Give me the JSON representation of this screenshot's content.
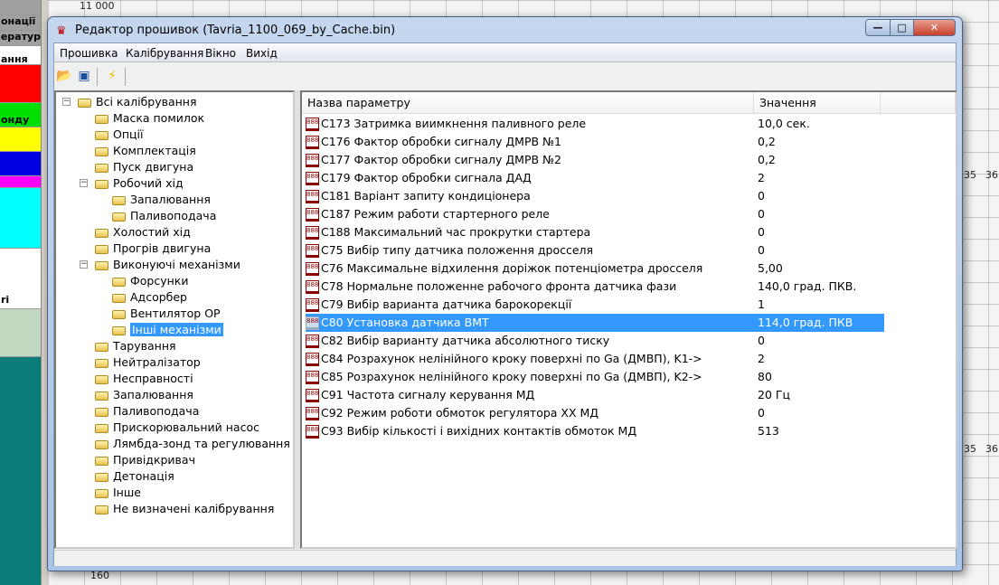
{
  "background": {
    "left_labels": [
      "онації",
      "ператур",
      "ання",
      "онду",
      "ri"
    ],
    "axis_labels": {
      "y_top": "11 000",
      "y_bottom": "160",
      "x_ticks": [
        "35",
        "36"
      ]
    },
    "strip_colors": [
      "#ff0000",
      "#00e000",
      "#ffff00",
      "#0000e0",
      "#ff00ff",
      "#00ffff",
      "#ffffff",
      "#c0d8c0"
    ]
  },
  "window": {
    "title": "Редактор прошивок (Tavria_1100_069_by_Cache.bin)",
    "minimize": "—",
    "maximize": "□",
    "close": "✕"
  },
  "menu": [
    "Прошивка",
    "Калібрування",
    "Вікно",
    "Вихід"
  ],
  "toolbar": {
    "icons": [
      "open-folder-icon",
      "save-disk-icon",
      "lightning-icon"
    ]
  },
  "tree": [
    {
      "label": "Всі калібрування",
      "level": 0,
      "expanded": true
    },
    {
      "label": "Маска помилок",
      "level": 1
    },
    {
      "label": "Опції",
      "level": 1
    },
    {
      "label": "Комплектація",
      "level": 1
    },
    {
      "label": "Пуск двигуна",
      "level": 1
    },
    {
      "label": "Робочий хід",
      "level": 1,
      "expanded": true
    },
    {
      "label": "Запалювання",
      "level": 2
    },
    {
      "label": "Паливоподача",
      "level": 2
    },
    {
      "label": "Холостий хід",
      "level": 1
    },
    {
      "label": "Прогрів двигуна",
      "level": 1
    },
    {
      "label": "Виконуючі механізми",
      "level": 1,
      "expanded": true
    },
    {
      "label": "Форсунки",
      "level": 2
    },
    {
      "label": "Адсорбер",
      "level": 2
    },
    {
      "label": "Вентилятор ОР",
      "level": 2
    },
    {
      "label": "Інші механізми",
      "level": 2,
      "selected": true
    },
    {
      "label": "Тарування",
      "level": 1
    },
    {
      "label": "Нейтралізатор",
      "level": 1
    },
    {
      "label": "Несправності",
      "level": 1
    },
    {
      "label": "Запалювання",
      "level": 1
    },
    {
      "label": "Паливоподача",
      "level": 1
    },
    {
      "label": "Прискорювальний насос",
      "level": 1
    },
    {
      "label": "Лямбда-зонд та регулювання",
      "level": 1
    },
    {
      "label": "Привідкривач",
      "level": 1
    },
    {
      "label": "Детонація",
      "level": 1
    },
    {
      "label": "Інше",
      "level": 1
    },
    {
      "label": "Не визначені калібрування",
      "level": 1
    }
  ],
  "list": {
    "columns": [
      "Назва параметру",
      "Значення"
    ],
    "rows": [
      {
        "name": "C173 Затримка виимкнення паливного реле",
        "value": "10,0 сек."
      },
      {
        "name": "C176 Фактор обробки сигналу ДМРВ №1",
        "value": "0,2"
      },
      {
        "name": "C177 Фактор обробки сигналу ДМРВ №2",
        "value": "0,2"
      },
      {
        "name": "C179 Фактор обробки сигнала ДАД",
        "value": "2"
      },
      {
        "name": "C181 Варіант запиту кондиціонера",
        "value": "0"
      },
      {
        "name": "C187 Режим работи стартерного реле",
        "value": "0"
      },
      {
        "name": "C188 Максимальний час прокрутки стартера",
        "value": "0"
      },
      {
        "name": "C75 Вибір типу датчика положення дросселя",
        "value": "0"
      },
      {
        "name": "C76 Максимальне відхилення доріжок потенціометра дросселя",
        "value": "5,00"
      },
      {
        "name": "C78 Нормальне положенне рабочого фронта датчика фази",
        "value": "140,0 град. ПКВ."
      },
      {
        "name": "C79 Вибір варианта датчика барокорекції",
        "value": "1"
      },
      {
        "name": "C80 Установка датчика ВМТ",
        "value": "114,0 град. ПКВ",
        "selected": true
      },
      {
        "name": "C82 Вибір варианту датчика абсолютного тиску",
        "value": "0"
      },
      {
        "name": "C84 Розрахунок нелінійного кроку поверхні по Ga (ДМВП), K1->",
        "value": "2"
      },
      {
        "name": "C85 Розрахунок нелінійного кроку поверхні по Ga (ДМВП), K2->",
        "value": "80"
      },
      {
        "name": "C91 Частота сигналу керування МД",
        "value": "20 Гц"
      },
      {
        "name": "C92 Режим роботи обмоток регулятора ХХ МД",
        "value": "0"
      },
      {
        "name": "C93 Вибір кількості і вихідних контактів обмоток МД",
        "value": "513"
      }
    ]
  }
}
